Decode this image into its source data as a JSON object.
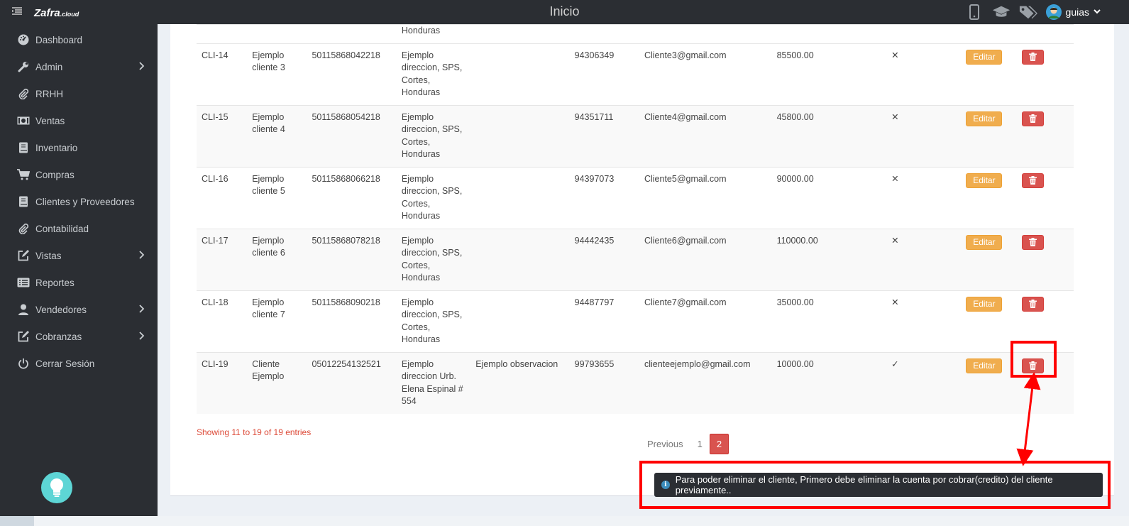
{
  "topbar": {
    "logo_main": "Zafra",
    "logo_sub": ".cloud",
    "title": "Inicio",
    "user_name": "guias"
  },
  "sidebar": {
    "items": [
      {
        "label": "Dashboard",
        "icon": "dashboard-icon",
        "has_submenu": false
      },
      {
        "label": "Admin",
        "icon": "wrench-icon",
        "has_submenu": true
      },
      {
        "label": "RRHH",
        "icon": "paperclip-icon",
        "has_submenu": false
      },
      {
        "label": "Ventas",
        "icon": "money-icon",
        "has_submenu": false
      },
      {
        "label": "Inventario",
        "icon": "book-icon",
        "has_submenu": false
      },
      {
        "label": "Compras",
        "icon": "cart-icon",
        "has_submenu": false
      },
      {
        "label": "Clientes y Proveedores",
        "icon": "book-icon",
        "has_submenu": false
      },
      {
        "label": "Contabilidad",
        "icon": "paperclip-icon",
        "has_submenu": false
      },
      {
        "label": "Vistas",
        "icon": "edit-icon",
        "has_submenu": true
      },
      {
        "label": "Reportes",
        "icon": "list-icon",
        "has_submenu": false
      },
      {
        "label": "Vendedores",
        "icon": "user-icon",
        "has_submenu": true
      },
      {
        "label": "Cobranzas",
        "icon": "edit-icon",
        "has_submenu": true
      },
      {
        "label": "Cerrar Sesión",
        "icon": "power-icon",
        "has_submenu": false
      }
    ]
  },
  "table": {
    "partial_top_text": "Honduras",
    "edit_label": "Editar",
    "rows": [
      {
        "code": "CLI-14",
        "name": [
          "Ejemplo",
          "cliente 3"
        ],
        "rtn": "50115868042218",
        "address": [
          "Ejemplo",
          "direccion, SPS,",
          "Cortes,",
          "Honduras"
        ],
        "obs": "",
        "phone": "94306349",
        "email": "Cliente3@gmail.com",
        "credit": "85500.00",
        "flag": "✕"
      },
      {
        "code": "CLI-15",
        "name": [
          "Ejemplo",
          "cliente 4"
        ],
        "rtn": "50115868054218",
        "address": [
          "Ejemplo",
          "direccion, SPS,",
          "Cortes,",
          "Honduras"
        ],
        "obs": "",
        "phone": "94351711",
        "email": "Cliente4@gmail.com",
        "credit": "45800.00",
        "flag": "✕"
      },
      {
        "code": "CLI-16",
        "name": [
          "Ejemplo",
          "cliente 5"
        ],
        "rtn": "50115868066218",
        "address": [
          "Ejemplo",
          "direccion, SPS,",
          "Cortes,",
          "Honduras"
        ],
        "obs": "",
        "phone": "94397073",
        "email": "Cliente5@gmail.com",
        "credit": "90000.00",
        "flag": "✕"
      },
      {
        "code": "CLI-17",
        "name": [
          "Ejemplo",
          "cliente 6"
        ],
        "rtn": "50115868078218",
        "address": [
          "Ejemplo",
          "direccion, SPS,",
          "Cortes,",
          "Honduras"
        ],
        "obs": "",
        "phone": "94442435",
        "email": "Cliente6@gmail.com",
        "credit": "110000.00",
        "flag": "✕"
      },
      {
        "code": "CLI-18",
        "name": [
          "Ejemplo",
          "cliente 7"
        ],
        "rtn": "50115868090218",
        "address": [
          "Ejemplo",
          "direccion, SPS,",
          "Cortes,",
          "Honduras"
        ],
        "obs": "",
        "phone": "94487797",
        "email": "Cliente7@gmail.com",
        "credit": "35000.00",
        "flag": "✕"
      },
      {
        "code": "CLI-19",
        "name": [
          "Cliente",
          "Ejemplo"
        ],
        "rtn": "05012254132521",
        "address": [
          "Ejemplo",
          "direccion Urb.",
          "Elena Espinal #",
          "554"
        ],
        "obs": "Ejemplo observacion",
        "phone": "99793655",
        "email": "clienteejemplo@gmail.com",
        "credit": "10000.00",
        "flag": "✓"
      }
    ]
  },
  "entries_info": "Showing 11 to 19 of 19 entries",
  "pagination": {
    "previous": "Previous",
    "pages": [
      "1",
      "2"
    ],
    "active": "2"
  },
  "toast": {
    "message": "Para poder eliminar el cliente, Primero debe eliminar la cuenta por cobrar(credito) del cliente previamente.."
  },
  "colors": {
    "sidebar_bg": "#2b2e33",
    "edit_btn": "#f0ad4e",
    "delete_btn": "#d9534f",
    "highlight": "#ff0000",
    "help_btn": "#5dd5d5"
  }
}
